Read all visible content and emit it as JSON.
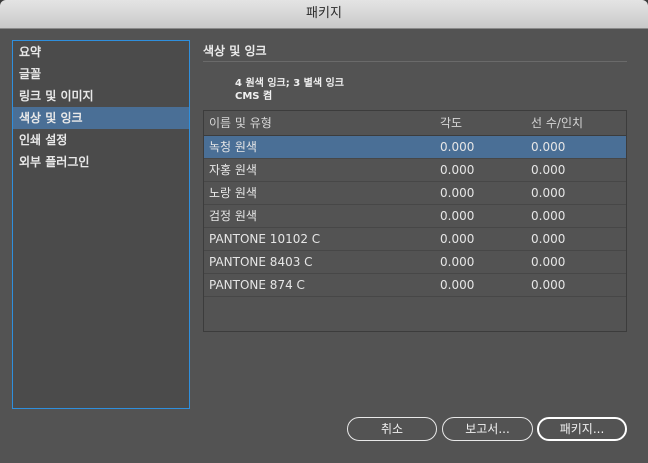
{
  "window": {
    "title": "패키지"
  },
  "sidebar": {
    "items": [
      {
        "label": "요약"
      },
      {
        "label": "글꼴"
      },
      {
        "label": "링크 및 이미지"
      },
      {
        "label": "색상 및 잉크"
      },
      {
        "label": "인쇄 설정"
      },
      {
        "label": "외부 플러그인"
      }
    ],
    "selected_index": 3
  },
  "main": {
    "section_title": "색상 및 잉크",
    "summary_line1": "4 원색 잉크; 3 별색 잉크",
    "summary_line2": "CMS 켬",
    "table": {
      "headers": {
        "name": "이름 및 유형",
        "angle": "각도",
        "lpi": "선 수/인치"
      },
      "rows": [
        {
          "name": "녹청 원색",
          "angle": "0.000",
          "lpi": "0.000"
        },
        {
          "name": "자홍 원색",
          "angle": "0.000",
          "lpi": "0.000"
        },
        {
          "name": "노랑 원색",
          "angle": "0.000",
          "lpi": "0.000"
        },
        {
          "name": "검정 원색",
          "angle": "0.000",
          "lpi": "0.000"
        },
        {
          "name": "PANTONE 10102 C",
          "angle": "0.000",
          "lpi": "0.000"
        },
        {
          "name": "PANTONE 8403 C",
          "angle": "0.000",
          "lpi": "0.000"
        },
        {
          "name": "PANTONE 874 C",
          "angle": "0.000",
          "lpi": "0.000"
        }
      ],
      "selected_index": 0
    }
  },
  "buttons": {
    "cancel": "취소",
    "report": "보고서...",
    "package": "패키지..."
  },
  "colors": {
    "selection": "#4a6f96",
    "focus_border": "#2f8fdd",
    "panel": "#535353"
  }
}
